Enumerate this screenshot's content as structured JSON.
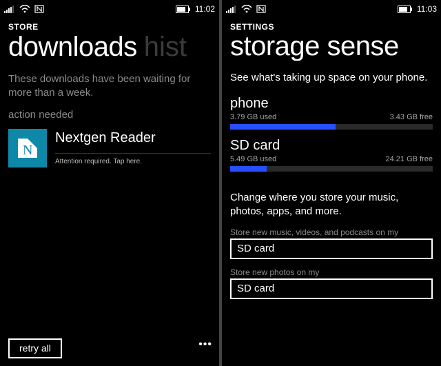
{
  "left": {
    "statusbar": {
      "time": "11:02"
    },
    "context": "STORE",
    "pivot": {
      "current": "downloads",
      "next": "hist"
    },
    "waiting_msg": "These downloads have been waiting for more than a week.",
    "action_needed": "action needed",
    "app": {
      "name": "Nextgen Reader",
      "attention": "Attention required. Tap here."
    },
    "appbar": {
      "retry": "retry all",
      "more": "•••"
    }
  },
  "right": {
    "statusbar": {
      "time": "11:03"
    },
    "context": "SETTINGS",
    "pivot": {
      "current": "storage sense"
    },
    "desc": "See what's taking up space on your phone.",
    "phone": {
      "label": "phone",
      "used": "3.79 GB used",
      "free": "3.43 GB free",
      "pct": 52
    },
    "sd": {
      "label": "SD card",
      "used": "5.49 GB used",
      "free": "24.21 GB free",
      "pct": 18
    },
    "change_desc": "Change where you store your music, photos, apps, and more.",
    "picker1": {
      "label": "Store new music, videos, and podcasts on my",
      "value": "SD card"
    },
    "picker2": {
      "label": "Store new photos on my",
      "value": "SD card"
    }
  }
}
